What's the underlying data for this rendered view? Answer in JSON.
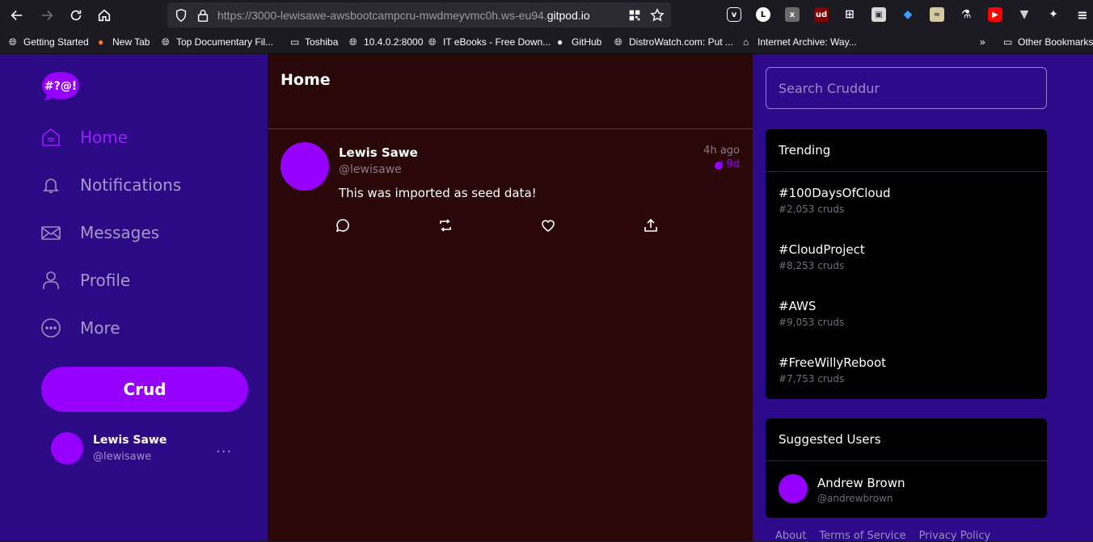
{
  "browser": {
    "url_prefix": "https://3000-lewisawe-awsbootcampcru-mwdmeyvmc0h.ws-eu94.",
    "url_host": "gitpod.io",
    "bookmarks": [
      "Getting Started",
      "New Tab",
      "Top Documentary Fil...",
      "Toshiba",
      "10.4.0.2:8000",
      "IT eBooks - Free Down...",
      "GitHub",
      "DistroWatch.com: Put ...",
      "Internet Archive: Way..."
    ],
    "other_bookmarks": "Other Bookmarks"
  },
  "sidebar": {
    "logo_text": "#?@!",
    "menu": [
      {
        "label": "Home",
        "icon": "home-icon"
      },
      {
        "label": "Notifications",
        "icon": "bell-icon"
      },
      {
        "label": "Messages",
        "icon": "envelope-icon"
      },
      {
        "label": "Profile",
        "icon": "person-icon"
      },
      {
        "label": "More",
        "icon": "more-circle-icon"
      }
    ],
    "crud_label": "Crud",
    "user": {
      "name": "Lewis Sawe",
      "handle": "@lewisawe",
      "more": "..."
    }
  },
  "feed": {
    "title": "Home",
    "posts": [
      {
        "name": "Lewis Sawe",
        "handle": "@lewisawe",
        "time": "4h ago",
        "expires": "9d",
        "body": "This was imported as seed data!"
      }
    ]
  },
  "right": {
    "search_placeholder": "Search Cruddur",
    "trending_title": "Trending",
    "trends": [
      {
        "name": "#100DaysOfCloud",
        "count": "#2,053 cruds"
      },
      {
        "name": "#CloudProject",
        "count": "#8,253 cruds"
      },
      {
        "name": "#AWS",
        "count": "#9,053 cruds"
      },
      {
        "name": "#FreeWillyReboot",
        "count": "#7,753 cruds"
      }
    ],
    "suggested_title": "Suggested Users",
    "suggested": [
      {
        "name": "Andrew Brown",
        "handle": "@andrewbrown"
      }
    ],
    "footer": [
      "About",
      "Terms of Service",
      "Privacy Policy"
    ]
  },
  "colors": {
    "accent": "#9500ff",
    "sidebar_bg": "#2c0a85",
    "feed_bg": "#2a0808",
    "box_bg": "#000000"
  }
}
